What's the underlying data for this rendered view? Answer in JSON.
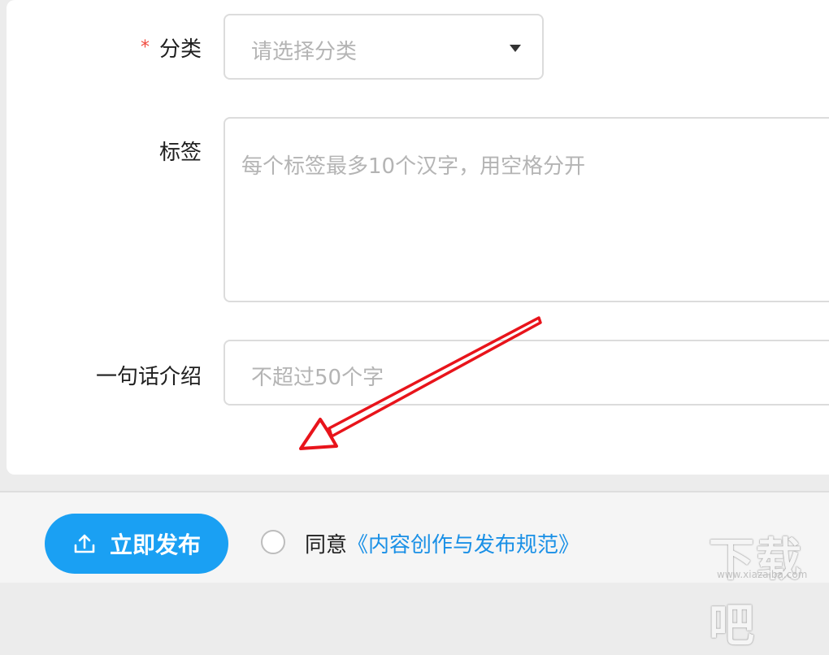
{
  "form": {
    "category": {
      "label": "分类",
      "required_mark": "*",
      "placeholder": "请选择分类"
    },
    "tags": {
      "label": "标签",
      "placeholder": "每个标签最多10个汉字，用空格分开"
    },
    "intro": {
      "label": "一句话介绍",
      "placeholder": "不超过50个字"
    }
  },
  "footer": {
    "publish_label": "立即发布",
    "agree_text": "同意",
    "agree_link": "《内容创作与发布规范》"
  },
  "watermark": {
    "text": "下载吧",
    "sub": "www.xiazaiba.com"
  },
  "colors": {
    "accent": "#1aa0f3",
    "link": "#1a90e6",
    "required": "#f04b3e",
    "annotation_arrow": "#e8141b"
  }
}
